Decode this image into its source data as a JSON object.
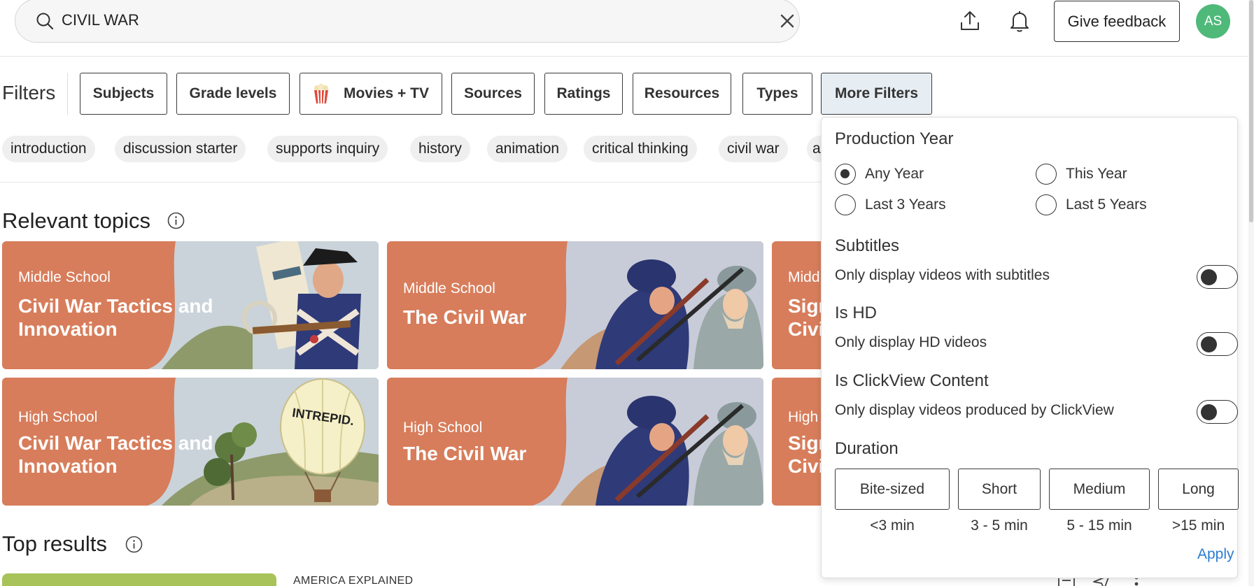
{
  "search": {
    "value": "CIVIL WAR"
  },
  "header": {
    "feedback_label": "Give feedback",
    "avatar_initials": "AS"
  },
  "filters": {
    "label": "Filters",
    "buttons": [
      "Subjects",
      "Grade levels",
      "Movies + TV",
      "Sources",
      "Ratings",
      "Resources",
      "Types",
      "More Filters"
    ]
  },
  "tags": [
    "introduction",
    "discussion starter",
    "supports inquiry",
    "history",
    "animation",
    "critical thinking",
    "civil war",
    "a"
  ],
  "relevant_topics": {
    "title": "Relevant topics",
    "cards": [
      {
        "level": "Middle School",
        "title": "Civil War Tactics and Innovation"
      },
      {
        "level": "Middle School",
        "title": "The Civil War"
      },
      {
        "level": "Midd",
        "title": "Sign Civi"
      },
      {
        "level": "High School",
        "title": "Civil War Tactics and Innovation"
      },
      {
        "level": "High School",
        "title": "The Civil War"
      },
      {
        "level": "High",
        "title": "Sign Civi"
      }
    ],
    "balloon_text": "INTREPID."
  },
  "top_results": {
    "title": "Top results",
    "first_source": "AMERICA EXPLAINED"
  },
  "more_filters": {
    "production_year": {
      "title": "Production Year",
      "options": [
        {
          "label": "Any Year",
          "checked": true
        },
        {
          "label": "This Year",
          "checked": false
        },
        {
          "label": "Last 3 Years",
          "checked": false
        },
        {
          "label": "Last 5 Years",
          "checked": false
        }
      ]
    },
    "subtitles": {
      "title": "Subtitles",
      "label": "Only display videos with subtitles",
      "on": false
    },
    "hd": {
      "title": "Is HD",
      "label": "Only display HD videos",
      "on": false
    },
    "clickview": {
      "title": "Is ClickView Content",
      "label": "Only display videos produced by ClickView",
      "on": false
    },
    "duration": {
      "title": "Duration",
      "options": [
        {
          "label": "Bite-sized",
          "range": "<3 min"
        },
        {
          "label": "Short",
          "range": "3 - 5 min"
        },
        {
          "label": "Medium",
          "range": "5 - 15 min"
        },
        {
          "label": "Long",
          "range": ">15 min"
        }
      ]
    },
    "apply_label": "Apply"
  },
  "colors": {
    "card": "#d77d5b",
    "accent": "#2a7dd1",
    "avatar": "#4fb97a"
  }
}
